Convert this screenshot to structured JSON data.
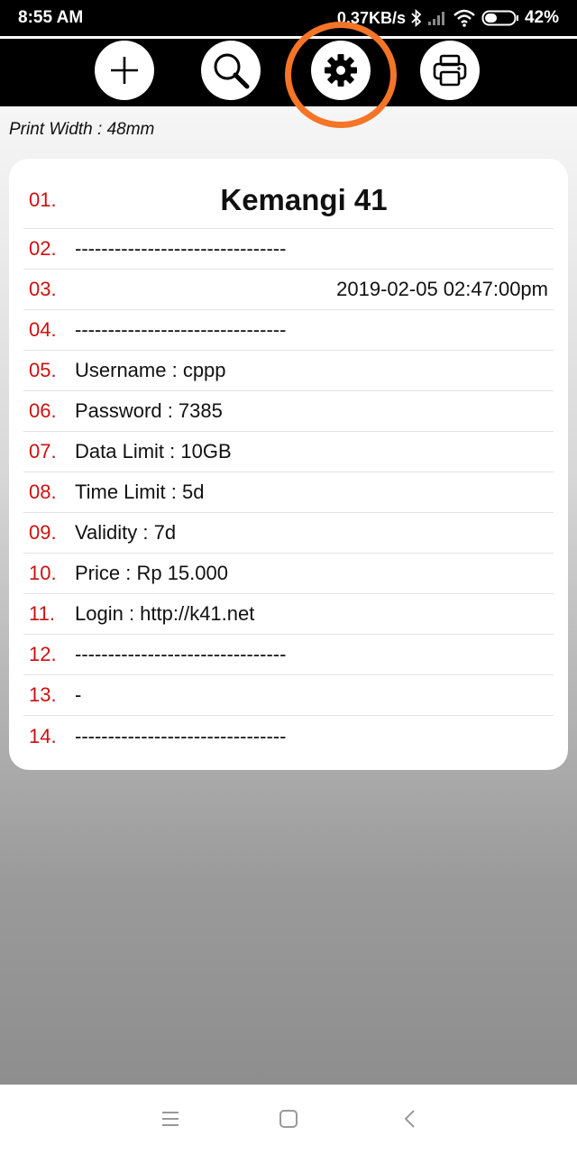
{
  "status_bar": {
    "time": "8:55 AM",
    "network_speed": "0.37KB/s",
    "battery_percent": "42%",
    "battery_level": 0.42,
    "icons": [
      "bluetooth-icon",
      "signal-icon",
      "wifi-icon",
      "battery-icon"
    ]
  },
  "toolbar": {
    "buttons": [
      {
        "icon": "plus-icon"
      },
      {
        "icon": "search-icon"
      },
      {
        "icon": "gear-icon",
        "highlighted": true
      },
      {
        "icon": "printer-icon"
      }
    ],
    "highlight_color": "#f57527"
  },
  "print_width": "Print Width : 48mm",
  "receipt": {
    "rows": [
      {
        "num": "01.",
        "text": "Kemangi 41"
      },
      {
        "num": "02.",
        "text": "--------------------------------"
      },
      {
        "num": "03.",
        "text": "2019-02-05 02:47:00pm"
      },
      {
        "num": "04.",
        "text": "--------------------------------"
      },
      {
        "num": "05.",
        "text": "Username : cppp"
      },
      {
        "num": "06.",
        "text": "Password : 7385"
      },
      {
        "num": "07.",
        "text": "Data Limit : 10GB"
      },
      {
        "num": "08.",
        "text": "Time Limit : 5d"
      },
      {
        "num": "09.",
        "text": "Validity : 7d"
      },
      {
        "num": "10.",
        "text": "Price : Rp 15.000"
      },
      {
        "num": "11.",
        "text": "Login : http://k41.net"
      },
      {
        "num": "12.",
        "text": "--------------------------------"
      },
      {
        "num": "13.",
        "text": "-"
      },
      {
        "num": "14.",
        "text": "--------------------------------"
      }
    ],
    "number_color": "#cc1010"
  },
  "nav_bar": {
    "buttons": [
      "menu-icon",
      "home-square-icon",
      "back-chevron-icon"
    ]
  }
}
